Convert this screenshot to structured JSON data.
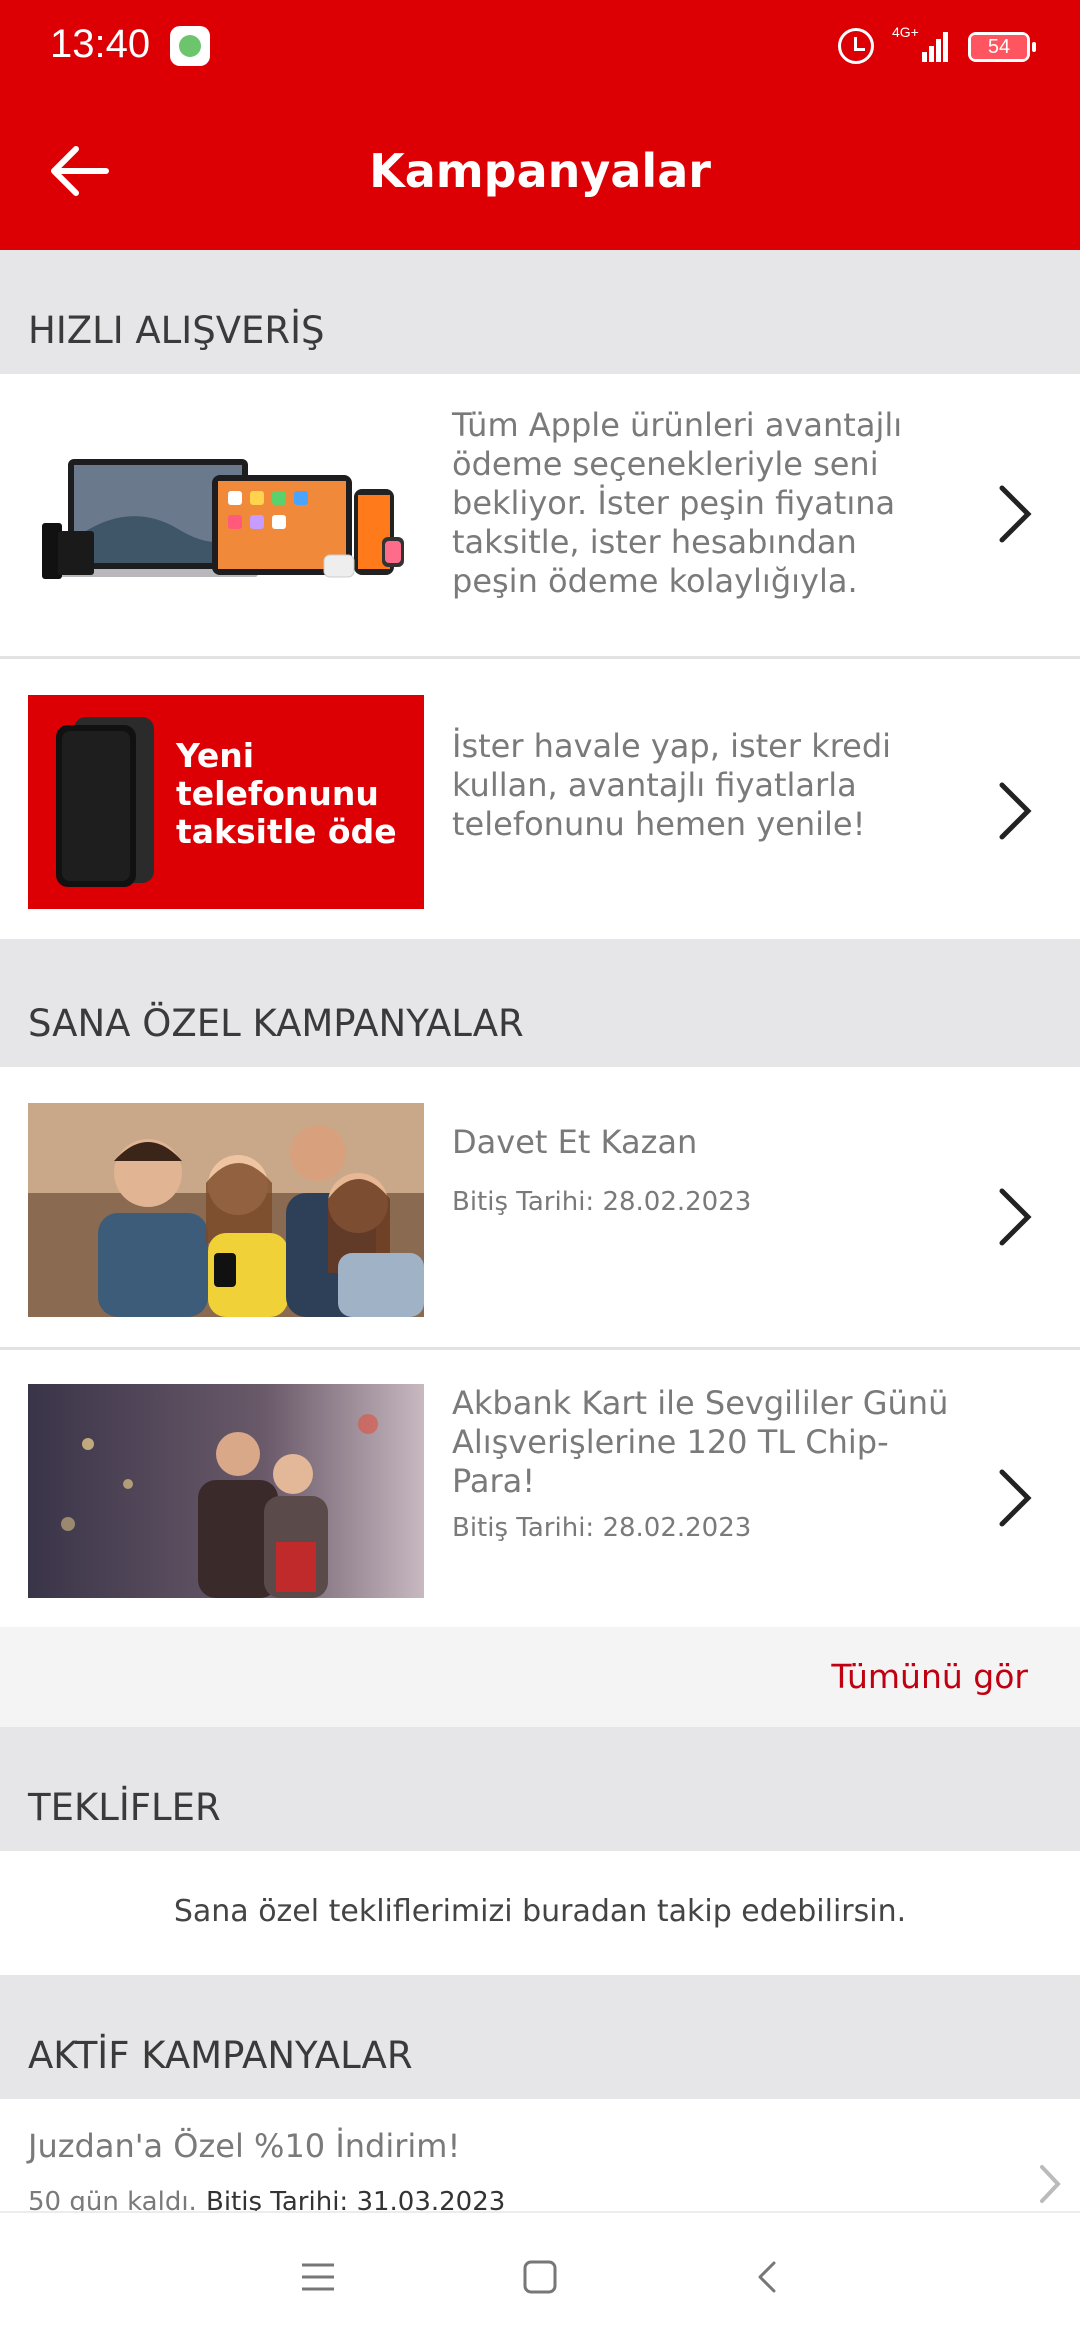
{
  "status_bar": {
    "time": "13:40",
    "network": "4G+",
    "battery": "54"
  },
  "header": {
    "title": "Kampanyalar",
    "back_icon": "arrow-left-icon"
  },
  "sections": {
    "quick_shopping": "HIZLI ALIŞVERİŞ",
    "special_campaigns": "SANA ÖZEL KAMPANYALAR",
    "offers": "TEKLİFLER",
    "active_campaigns": "AKTİF KAMPANYALAR"
  },
  "quick_shopping": [
    {
      "image": "apple-devices-image",
      "text": "Tüm Apple ürünleri avantajlı ödeme seçenekleriyle seni bekliyor.  İster peşin fiyatına taksitle, ister hesabından peşin ödeme kolaylığıyla."
    },
    {
      "image_text": "Yeni telefonunu taksitle öde",
      "text": "İster havale yap, ister kredi kullan, avantajlı fiyatlarla telefonunu hemen yenile!"
    }
  ],
  "special_campaigns": [
    {
      "title": "Davet Et Kazan",
      "end_date": "Bitiş Tarihi: 28.02.2023"
    },
    {
      "title": "Akbank Kart ile Sevgililer Günü Alışverişlerine 120 TL Chip-Para!",
      "end_date": "Bitiş Tarihi: 28.02.2023"
    }
  ],
  "see_all": "Tümünü gör",
  "offers_text": "Sana özel tekliflerimizi buradan takip edebilirsin.",
  "active_campaign": {
    "title": "Juzdan'a Özel %10 İndirim!",
    "days_left": "50 gün kaldı.",
    "end_date": "Bitiş Tarihi: 31.03.2023"
  },
  "colors": {
    "brand_red": "#dc0005",
    "link_red": "#c00010"
  },
  "nav_icons": [
    "menu-icon",
    "home-square-icon",
    "back-triangle-icon"
  ]
}
